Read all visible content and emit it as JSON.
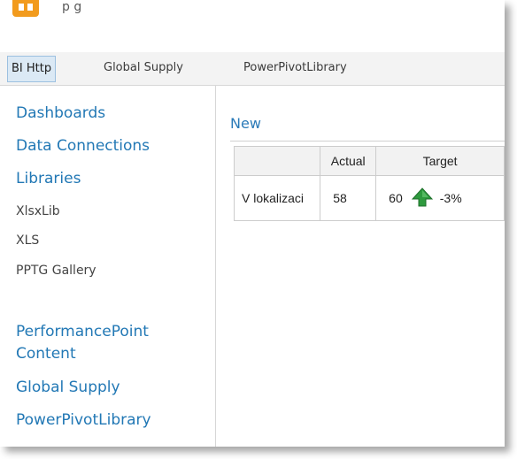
{
  "window": {
    "title_fragment": "p   g"
  },
  "tabs": [
    {
      "label": "BI Http",
      "active": true
    },
    {
      "label": "Global Supply",
      "active": false
    },
    {
      "label": "PowerPivotLibrary",
      "active": false
    }
  ],
  "quick_launch": {
    "links": [
      {
        "label": "Dashboards"
      },
      {
        "label": "Data Connections"
      },
      {
        "label": "Libraries"
      }
    ],
    "sub_items": [
      {
        "label": "XlsxLib"
      },
      {
        "label": "XLS"
      },
      {
        "label": "PPTG Gallery"
      }
    ],
    "lists": [
      {
        "label": "PerformancePoint Content"
      },
      {
        "label": "Global Supply"
      },
      {
        "label": "PowerPivotLibrary"
      }
    ]
  },
  "main": {
    "new_link": "New",
    "scorecard": {
      "headers": [
        "",
        "Actual",
        "Target"
      ],
      "row": {
        "label": "V lokalizaci",
        "actual": "58",
        "target": "60",
        "variance": "-3%",
        "indicator": "green-up-arrow-icon"
      }
    }
  },
  "colors": {
    "link": "#2278b5",
    "active_tab_bg": "#dbe9f5",
    "indicator_green": "#2e9a3e",
    "logo": "#f29b1d"
  }
}
